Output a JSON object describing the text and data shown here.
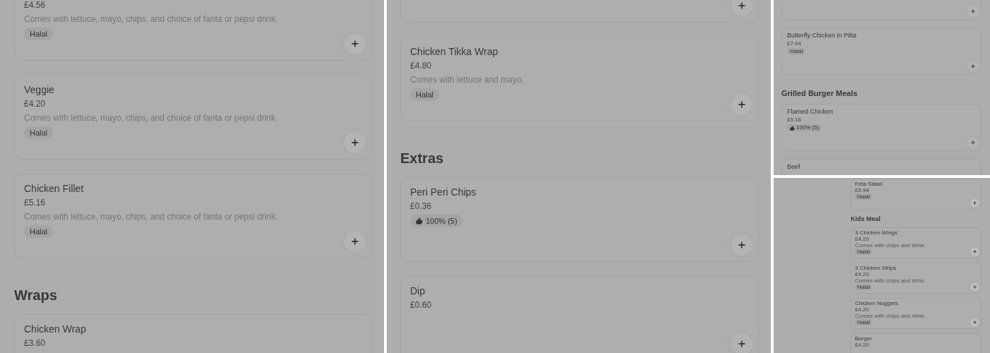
{
  "panels": [
    {
      "entries": [
        {
          "kind": "item",
          "price": "£4.56",
          "description": "Comes with lettuce, mayo, chips, and choice of fanta or pepsi drink.",
          "tag": {
            "kind": "label",
            "text": "Halal"
          },
          "add_button": true
        },
        {
          "kind": "item",
          "name": "Veggie",
          "price": "£4.20",
          "description": "Comes with lettuce, mayo, chips, and choice of fanta or pepsi drink.",
          "tag": {
            "kind": "label",
            "text": "Halal"
          },
          "add_button": true
        },
        {
          "kind": "item",
          "name": "Chicken Fillet",
          "price": "£5.16",
          "description": "Comes with lettuce, mayo, chips, and choice of fanta or pepsi drink.",
          "tag": {
            "kind": "label",
            "text": "Halal"
          },
          "add_button": true
        },
        {
          "kind": "section",
          "title": "Wraps"
        },
        {
          "kind": "item",
          "name": "Chicken Wrap",
          "price": "£3.60"
        }
      ]
    },
    {
      "entries": [
        {
          "kind": "item",
          "add_button": true
        },
        {
          "kind": "item",
          "name": "Chicken Tikka Wrap",
          "price": "£4.80",
          "description": "Comes with lettuce and mayo.",
          "tag": {
            "kind": "label",
            "text": "Halal"
          },
          "add_button": true
        },
        {
          "kind": "section",
          "title": "Extras"
        },
        {
          "kind": "item",
          "name": "Peri Peri Chips",
          "price": "£0.36",
          "tag": {
            "kind": "rating",
            "text": "100% (5)"
          },
          "add_button": true
        },
        {
          "kind": "item",
          "name": "Dip",
          "price": "£0.60",
          "add_button": true
        }
      ]
    },
    {
      "entries": [
        {
          "kind": "item",
          "add_button": true
        },
        {
          "kind": "item",
          "name": "Butterfly Chicken in Pitta",
          "price": "£7.44",
          "tag": {
            "kind": "label",
            "text": "Halal"
          },
          "add_button": true
        },
        {
          "kind": "section",
          "title": "Grilled Burger Meals"
        },
        {
          "kind": "item",
          "name": "Flamed Chicken",
          "price": "£5.16",
          "tag": {
            "kind": "rating",
            "text": "100% (5)"
          },
          "add_button": true
        },
        {
          "kind": "item",
          "name": "Beef"
        }
      ]
    },
    {
      "entries": [
        {
          "kind": "item",
          "name": "Feta Salad",
          "price": "£5.94",
          "tag": {
            "kind": "label",
            "text": "Halal"
          },
          "add_button": true
        },
        {
          "kind": "section",
          "title": "Kids Meal"
        },
        {
          "kind": "item",
          "name": "3 Chicken Wings",
          "price": "£4.20",
          "description": "Comes with chips and drink.",
          "tag": {
            "kind": "label",
            "text": "Halal"
          },
          "add_button": true
        },
        {
          "kind": "item",
          "name": "3 Chicken Strips",
          "price": "£4.20",
          "description": "Comes with chips and drink.",
          "tag": {
            "kind": "label",
            "text": "Halal"
          },
          "add_button": true
        },
        {
          "kind": "item",
          "name": "Chicken Nuggets",
          "price": "£4.20",
          "description": "Comes with chips and drink.",
          "tag": {
            "kind": "label",
            "text": "Halal"
          },
          "add_button": true
        },
        {
          "kind": "item",
          "name": "Burger",
          "price": "£4.20"
        }
      ]
    }
  ]
}
